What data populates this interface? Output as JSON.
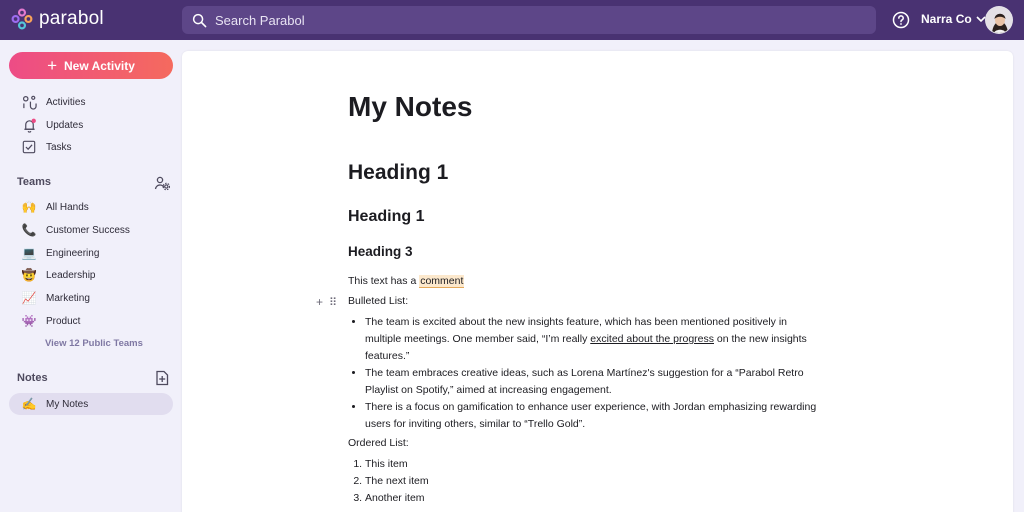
{
  "app": {
    "name": "parabol"
  },
  "search": {
    "placeholder": "Search Parabol"
  },
  "org": {
    "name": "Narra Co"
  },
  "sidebar": {
    "new_activity_label": "New Activity",
    "main_items": [
      {
        "label": "Activities",
        "icon": "activities-icon"
      },
      {
        "label": "Updates",
        "icon": "bell-icon"
      },
      {
        "label": "Tasks",
        "icon": "checkbox-icon"
      }
    ],
    "teams_title": "Teams",
    "teams": [
      {
        "label": "All Hands",
        "emoji": "🙌"
      },
      {
        "label": "Customer Success",
        "emoji": "📞"
      },
      {
        "label": "Engineering",
        "emoji": "💻"
      },
      {
        "label": "Leadership",
        "emoji": "🤠"
      },
      {
        "label": "Marketing",
        "emoji": "📈"
      },
      {
        "label": "Product",
        "emoji": "👾"
      }
    ],
    "view_public_teams": "View 12 Public Teams",
    "notes_title": "Notes",
    "notes": [
      {
        "label": "My Notes",
        "emoji": "✍️"
      }
    ]
  },
  "doc": {
    "title": "My Notes",
    "heading1a": "Heading 1",
    "heading1b": "Heading 1",
    "heading3": "Heading 3",
    "comment_line": {
      "before": "This text has a ",
      "comment": "comment"
    },
    "bulleted_label": "Bulleted List:",
    "bullets": [
      {
        "line1": "The team is excited about the new insights feature, which has been mentioned positively in",
        "line2_before": "multiple meetings. One member said, “I’m really ",
        "line2_link": "excited about the progress",
        "line2_after": " on the new insights",
        "line3": "features.”"
      },
      {
        "line1": "The team embraces creative ideas, such as Lorena Martínez's suggestion for a “Parabol Retro",
        "line2": "Playlist on Spotify,” aimed at increasing engagement."
      },
      {
        "line1": "There is a focus on gamification to enhance user experience, with Jordan emphasizing rewarding",
        "line2": "users for inviting others, similar to “Trello Gold”."
      }
    ],
    "ordered_label": "Ordered List:",
    "ordered": [
      "This item",
      "The next item",
      "Another item"
    ]
  },
  "colors": {
    "topbar": "#493272",
    "sidebar_bg": "#f1f0fa",
    "accent_gradient_start": "#ed4c86",
    "accent_gradient_end": "#f56a5e",
    "comment_highlight": "#fce8cc"
  }
}
